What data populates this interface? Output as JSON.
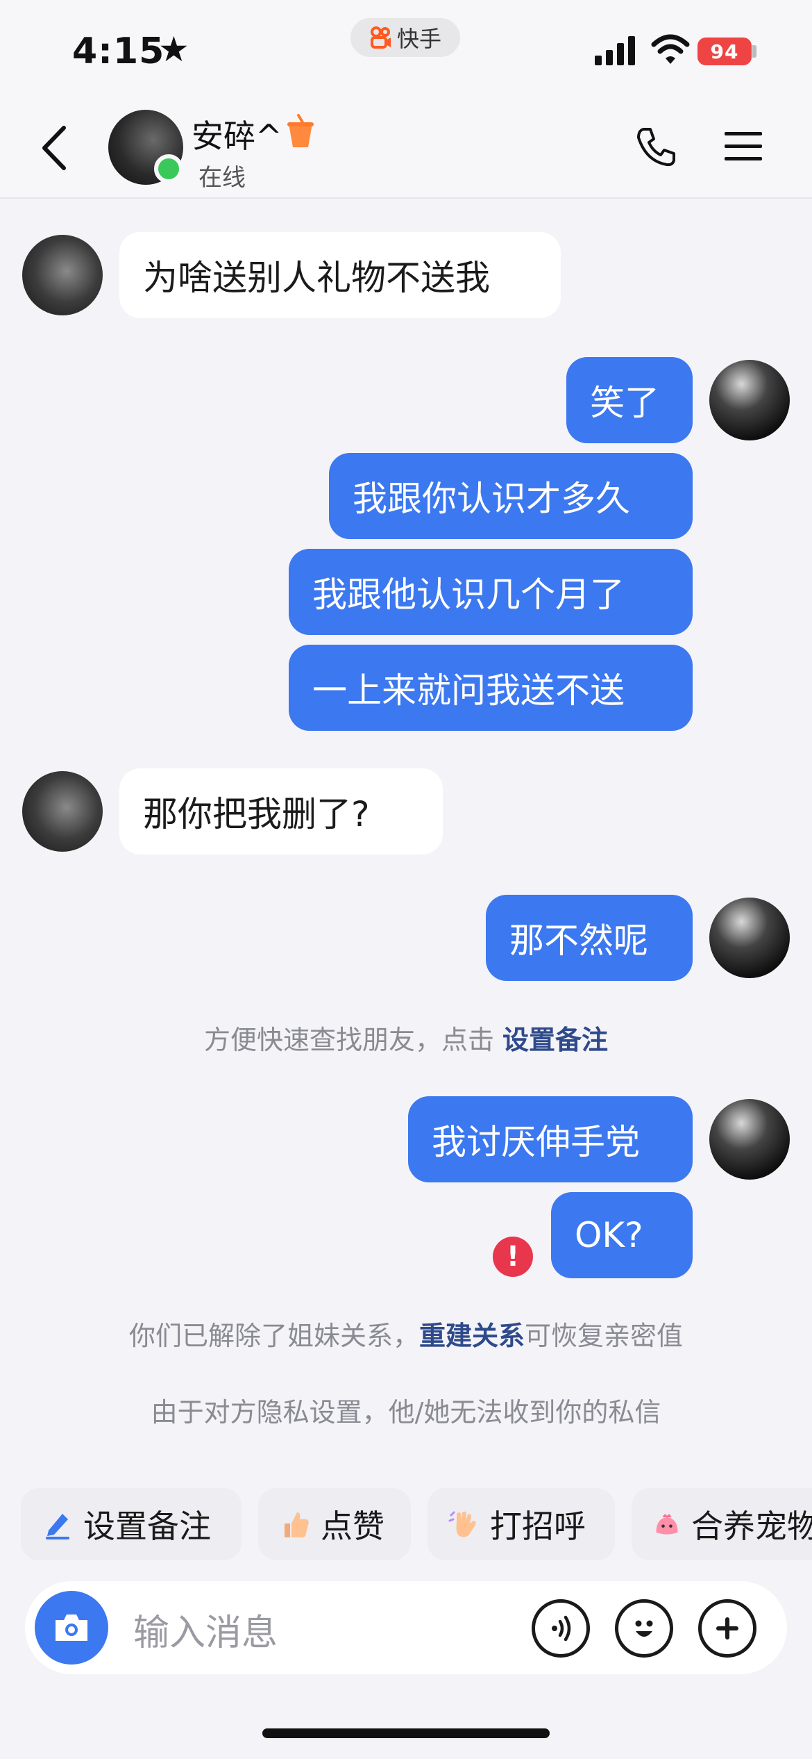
{
  "status_bar": {
    "time": "4:15",
    "app_name": "快手",
    "battery": "94"
  },
  "header": {
    "contact_name": "安碎^",
    "status": "在线"
  },
  "messages": [
    {
      "side": "in",
      "text": "为啥送别人礼物不送我"
    },
    {
      "side": "out",
      "text": "笑了"
    },
    {
      "side": "out",
      "text": "我跟你认识才多久"
    },
    {
      "side": "out",
      "text": "我跟他认识几个月了"
    },
    {
      "side": "out",
      "text": "一上来就问我送不送"
    },
    {
      "side": "in",
      "text": "那你把我删了?"
    },
    {
      "side": "out",
      "text": "那不然呢"
    },
    {
      "side": "out",
      "text": "我讨厌伸手党"
    },
    {
      "side": "out",
      "text": "OK?",
      "failed": true
    }
  ],
  "system": {
    "remark_tip": "方便快速查找朋友，点击 ",
    "remark_link": "设置备注",
    "relation_pre": "你们已解除了姐妹关系，",
    "relation_link": "重建关系",
    "relation_post": "可恢复亲密值",
    "privacy_tip": "由于对方隐私设置，他/她无法收到你的私信",
    "error_mark": "!"
  },
  "quick_actions": [
    {
      "label": "设置备注",
      "icon": "pencil-icon"
    },
    {
      "label": "点赞",
      "icon": "thumbs-up-icon"
    },
    {
      "label": "打招呼",
      "icon": "wave-hand-icon"
    },
    {
      "label": "合养宠物",
      "icon": "pet-icon"
    }
  ],
  "input": {
    "placeholder": "输入消息"
  },
  "colors": {
    "accent": "#3c78f0",
    "online": "#3bc85a",
    "error": "#e8364c",
    "link": "#2e4a8a"
  }
}
